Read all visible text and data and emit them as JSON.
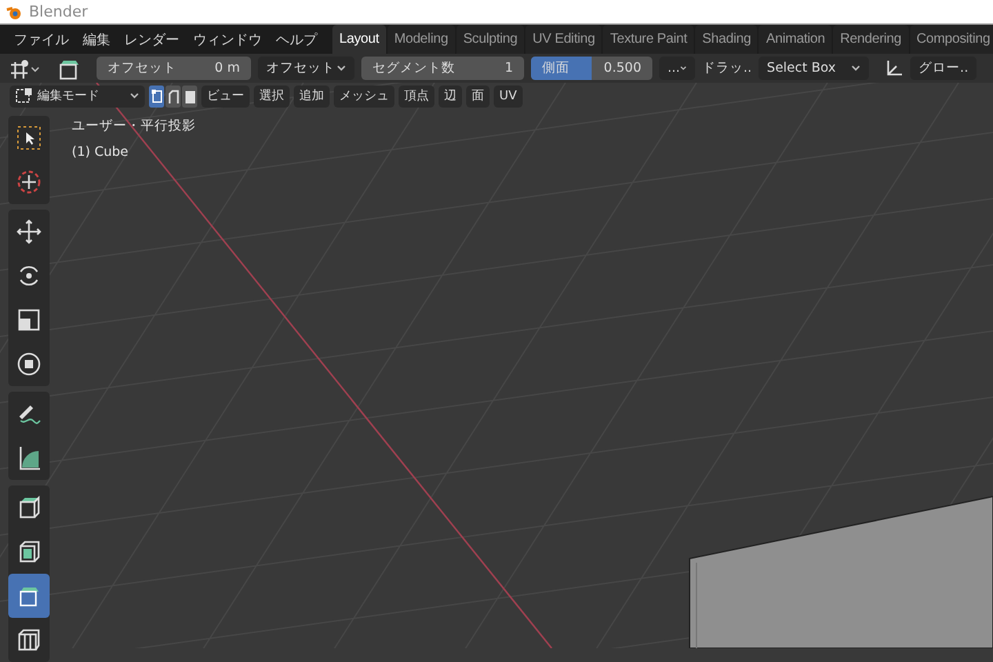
{
  "window": {
    "title": "Blender"
  },
  "menu": [
    "ファイル",
    "編集",
    "レンダー",
    "ウィンドウ",
    "ヘルプ"
  ],
  "workspace_tabs": [
    {
      "label": "Layout",
      "selected": true
    },
    {
      "label": "Modeling",
      "selected": false
    },
    {
      "label": "Sculpting",
      "selected": false
    },
    {
      "label": "UV Editing",
      "selected": false
    },
    {
      "label": "Texture Paint",
      "selected": false
    },
    {
      "label": "Shading",
      "selected": false
    },
    {
      "label": "Animation",
      "selected": false
    },
    {
      "label": "Rendering",
      "selected": false
    },
    {
      "label": "Compositing",
      "selected": false
    }
  ],
  "tool_settings": {
    "offset_label": "オフセット",
    "offset_value": "0 m",
    "offset_type": "オフセット",
    "segments_label": "セグメント数",
    "segments_value": "1",
    "profile": {
      "label": "側面",
      "value": "0.500",
      "level": 0.5
    },
    "more": "...",
    "drag_label": "ドラッ..",
    "select_mode": "Select Box",
    "orientation": "グロー.."
  },
  "header": {
    "mode": "編集モード",
    "select_modes": [
      {
        "kind": "vertex",
        "selected": true
      },
      {
        "kind": "edge",
        "selected": false
      },
      {
        "kind": "face",
        "selected": false
      }
    ],
    "menus": [
      "ビュー",
      "選択",
      "追加",
      "メッシュ",
      "頂点",
      "辺",
      "面",
      "UV"
    ]
  },
  "toolbar": [
    [
      {
        "kind": "select",
        "selected": false
      },
      {
        "kind": "cursor",
        "selected": false
      }
    ],
    [
      {
        "kind": "move",
        "selected": false
      },
      {
        "kind": "rotate",
        "selected": false
      },
      {
        "kind": "scale",
        "selected": false
      },
      {
        "kind": "transform",
        "selected": false
      }
    ],
    [
      {
        "kind": "annotate",
        "selected": false
      },
      {
        "kind": "measure",
        "selected": false
      }
    ],
    [
      {
        "kind": "extrude",
        "selected": false
      },
      {
        "kind": "inset",
        "selected": false
      },
      {
        "kind": "bevel",
        "selected": true
      },
      {
        "kind": "loopcut",
        "selected": false
      }
    ]
  ],
  "viewport": {
    "view_name": "ユーザー・平行投影",
    "object": "(1) Cube"
  }
}
